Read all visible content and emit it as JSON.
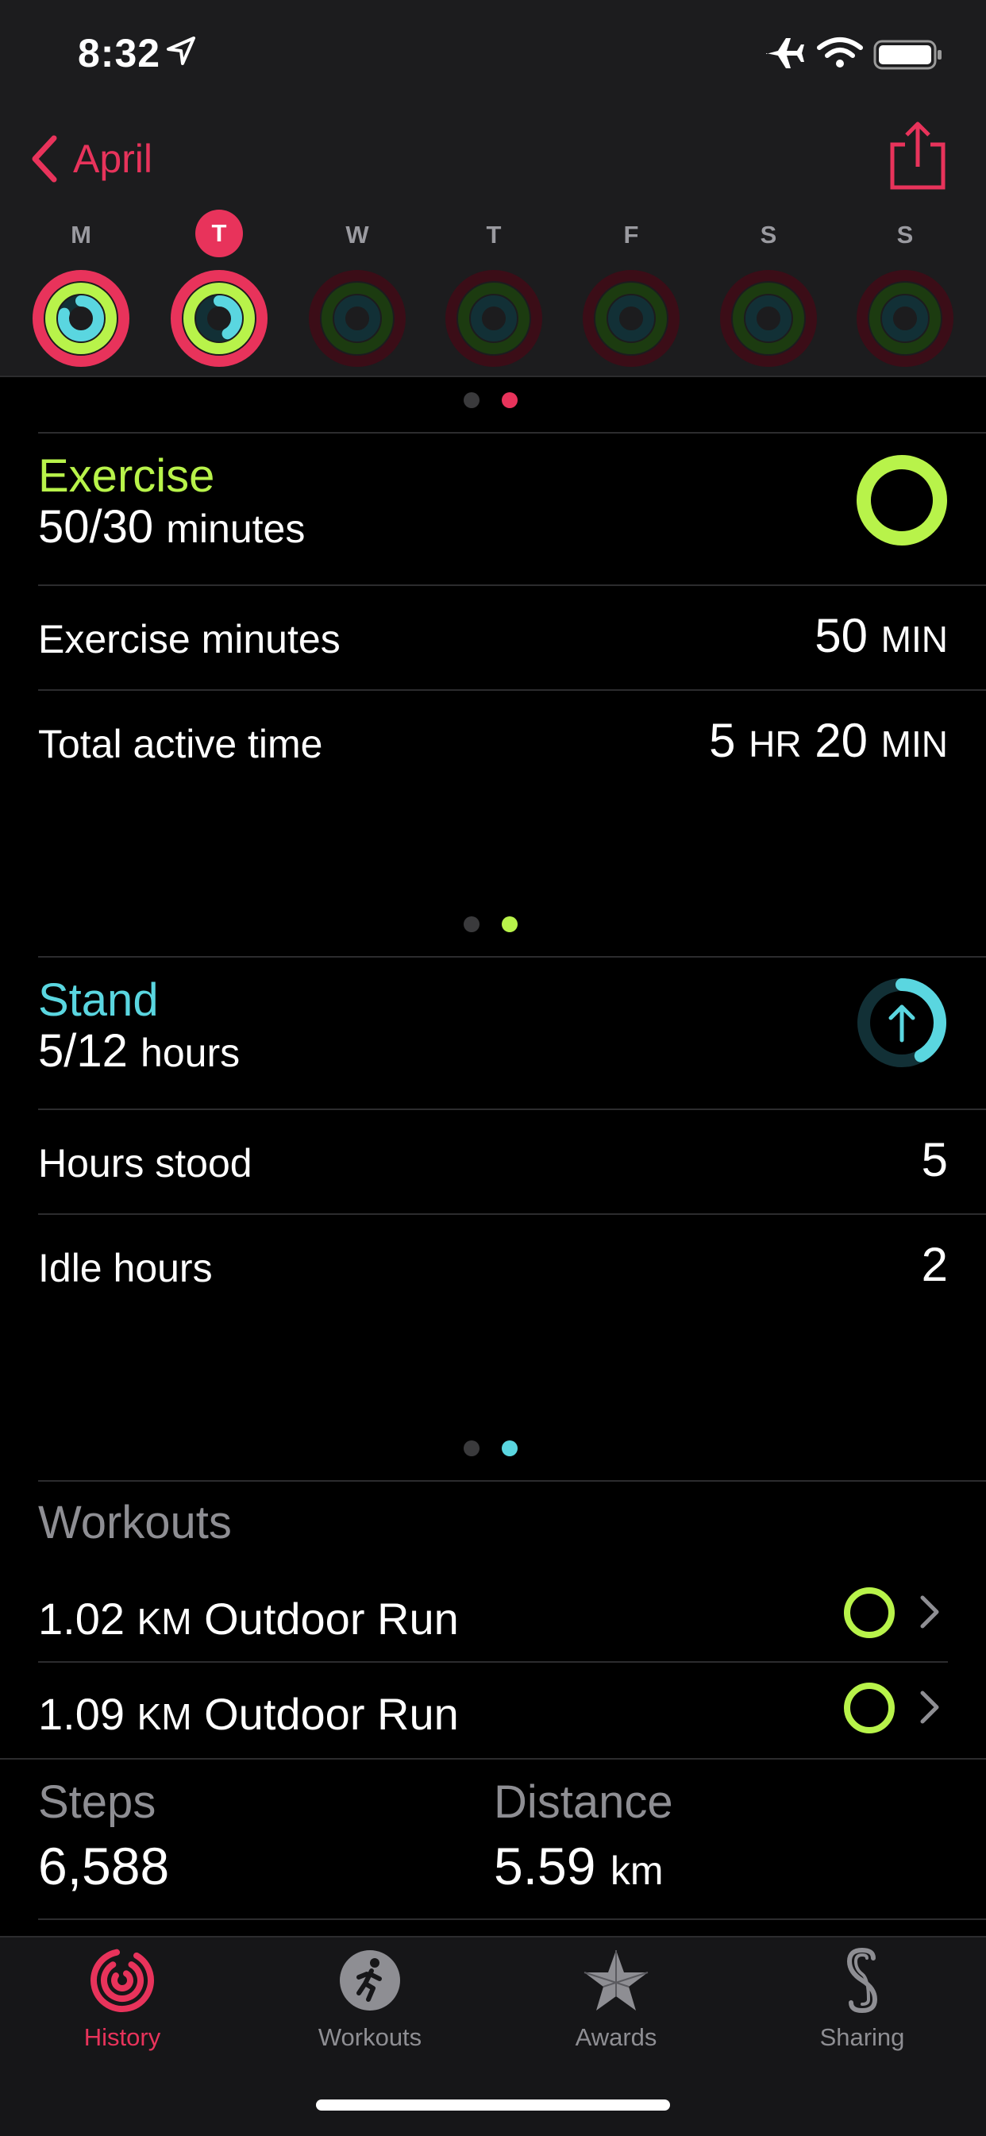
{
  "status_bar": {
    "time": "8:32"
  },
  "nav": {
    "back_label": "April"
  },
  "week": {
    "days": [
      "M",
      "T",
      "W",
      "T",
      "F",
      "S",
      "S"
    ],
    "selected_index": 1
  },
  "exercise": {
    "title": "Exercise",
    "progress": "50/30",
    "progress_unit": "minutes",
    "rows": [
      {
        "label": "Exercise minutes",
        "value": "50",
        "unit": "MIN"
      },
      {
        "label": "Total active time",
        "value_hr": "5",
        "unit_hr": "HR",
        "value_min": "20",
        "unit_min": "MIN"
      }
    ],
    "color": "#b8f34a"
  },
  "stand": {
    "title": "Stand",
    "progress": "5/12",
    "progress_unit": "hours",
    "rows": [
      {
        "label": "Hours stood",
        "value": "5"
      },
      {
        "label": "Idle hours",
        "value": "2"
      }
    ],
    "color": "#5ad6e0",
    "fraction": 0.4167
  },
  "workouts": {
    "title": "Workouts",
    "items": [
      {
        "distance": "1.02",
        "unit": "KM",
        "name": "Outdoor Run"
      },
      {
        "distance": "1.09",
        "unit": "KM",
        "name": "Outdoor Run"
      }
    ]
  },
  "summary": {
    "steps_label": "Steps",
    "steps_value": "6,588",
    "distance_label": "Distance",
    "distance_value": "5.59",
    "distance_unit": "km"
  },
  "tabs": [
    {
      "label": "History",
      "icon": "history-rings-icon",
      "active": true
    },
    {
      "label": "Workouts",
      "icon": "runner-icon",
      "active": false
    },
    {
      "label": "Awards",
      "icon": "star-award-icon",
      "active": false
    },
    {
      "label": "Sharing",
      "icon": "sharing-icon",
      "active": false
    }
  ],
  "colors": {
    "accent": "#e8335b",
    "move": "#e8335b",
    "exercise": "#b8f34a",
    "stand": "#5ad6e0"
  }
}
